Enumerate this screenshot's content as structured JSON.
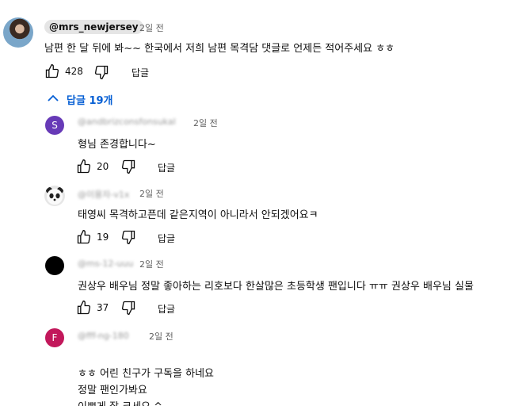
{
  "main_comment": {
    "handle": "@mrs_newjersey",
    "time": "2일 전",
    "text": "남편 한 달 뒤에 봐~~ 한국에서 저희 남편 목격담 댓글로 언제든 적어주세요 ㅎㅎ",
    "likes": "428",
    "reply_label": "답글"
  },
  "replies_toggle": {
    "label": "답글 19개",
    "icon": "chevron-up-icon",
    "color": "#065fd4"
  },
  "replies": [
    {
      "avatar_letter": "S",
      "avatar_color": "#673ab7",
      "handle": "@andbrizconsfonsukal",
      "time": "2일 전",
      "lines": [
        "형님 존경합니다~"
      ],
      "likes": "20",
      "reply_label": "답글"
    },
    {
      "avatar_letter": "",
      "avatar_icon": "panda-avatar",
      "handle": "@이용자-v1x",
      "time": "2일 전",
      "lines": [
        "태영씨 목격하고픈데 같은지역이 아니라서 안되겠어요ㅋ"
      ],
      "likes": "19",
      "reply_label": "답글"
    },
    {
      "avatar_letter": "",
      "avatar_color": "#000000",
      "handle": "@ms-12-uuu",
      "time": "2일 전",
      "lines": [
        "권상우 배우님 정말 좋아하는 리호보다 한살많은 초등학생 팬입니다 ㅠㅠ 권상우 배우님 실물"
      ],
      "likes": "37",
      "reply_label": "답글"
    },
    {
      "avatar_letter": "F",
      "avatar_color": "#c2185b",
      "handle": "@fff-ng-180",
      "time": "2일 전",
      "lines": [
        "ㅎㅎ 어린 친구가 구독을 하네요",
        "정말 팬인가봐요",
        "이쁘게 잘 크세요 ^"
      ]
    }
  ]
}
